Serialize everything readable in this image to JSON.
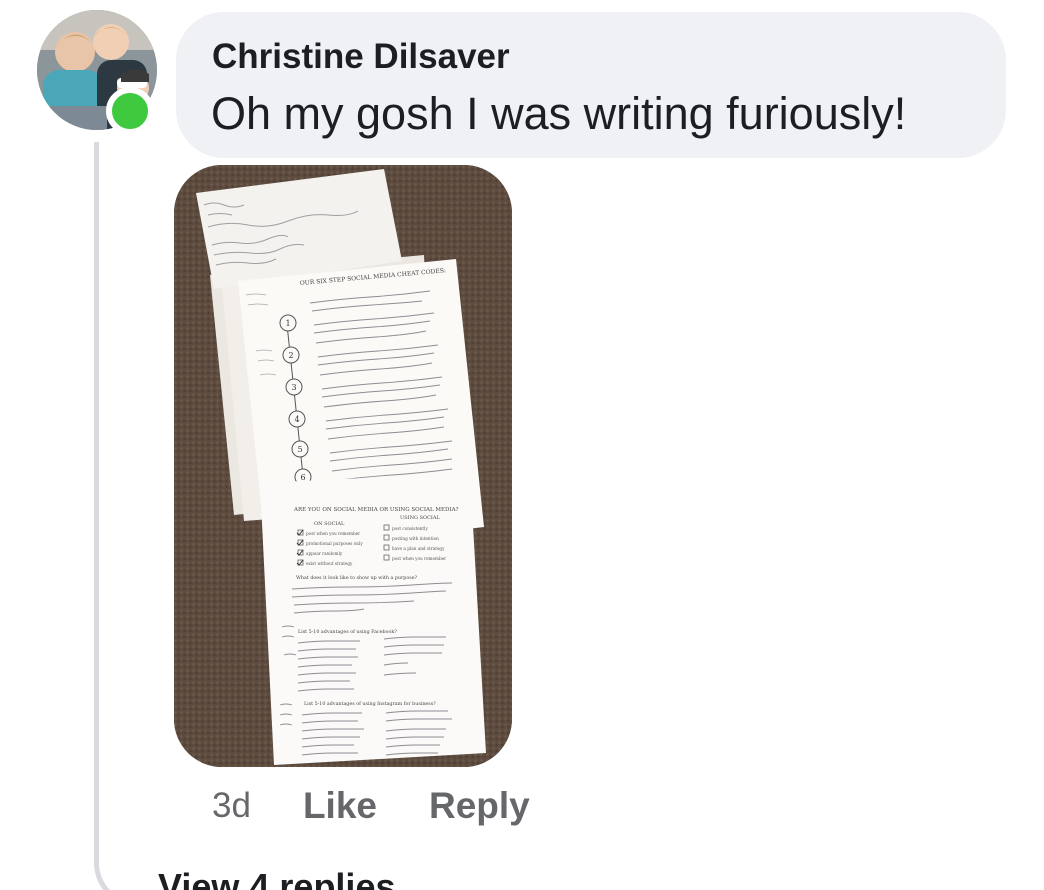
{
  "comment": {
    "author": "Christine Dilsaver",
    "text": "Oh my gosh I was writing furiously!",
    "online": true,
    "online_color": "#3ec93e",
    "attachment": {
      "type": "photo",
      "upper_sheet_title": "OUR SIX STEP SOCIAL MEDIA CHEAT CODES:",
      "steps": [
        "1",
        "2",
        "3",
        "4",
        "5",
        "6"
      ],
      "lower_sheet_title": "ARE YOU ON SOCIAL MEDIA OR USING SOCIAL MEDIA?",
      "on_social_heading": "ON SOCIAL",
      "using_social_heading": "USING SOCIAL",
      "on_social_items": [
        "post when you remember",
        "promotional purposes only",
        "appear randomly",
        "exist without strategy"
      ],
      "using_social_items": [
        "post consistently",
        "posting with intention",
        "have a plan and strategy",
        "post when you remember"
      ],
      "question": "What does it look like to show up with a purpose?",
      "facebook_prompt": "List 5-10 advantages of using Facebook?",
      "instagram_prompt": "List 5-10 advantages of using Instagram for business?"
    }
  },
  "actions": {
    "time": "3d",
    "like": "Like",
    "reply": "Reply"
  },
  "view_replies": "View 4 replies",
  "colors": {
    "bubble": "#f0f1f5",
    "secondary_text": "#65676b",
    "primary_text": "#1c1e21"
  }
}
